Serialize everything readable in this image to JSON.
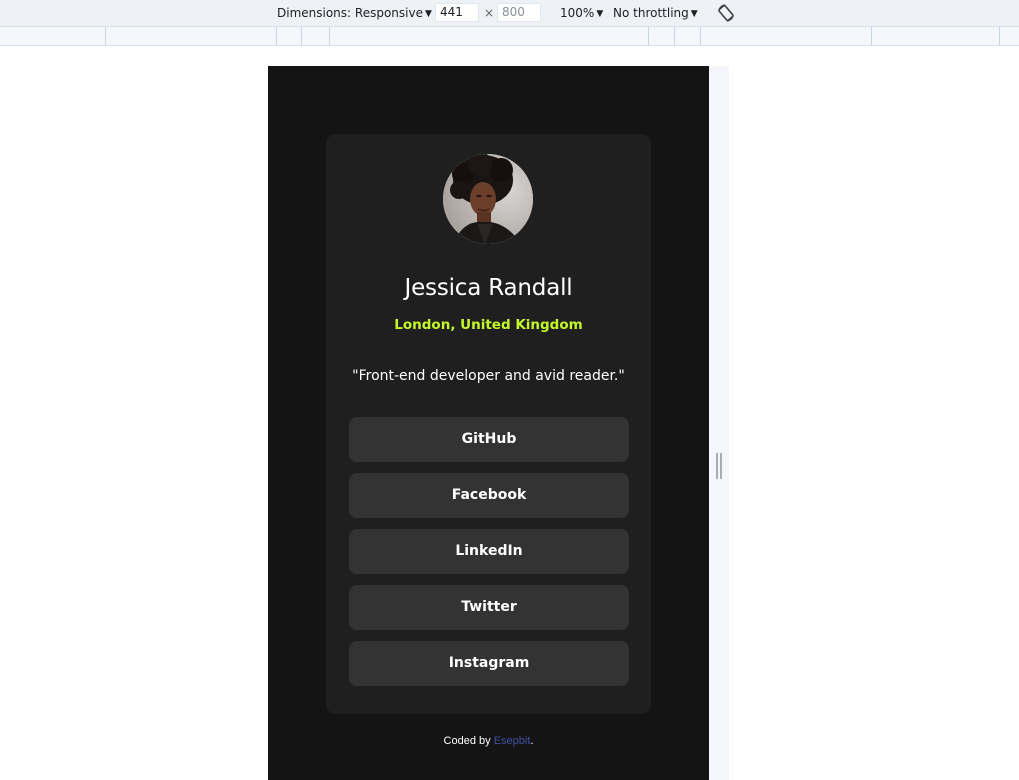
{
  "devtools": {
    "dimensions_label": "Dimensions: Responsive",
    "width_value": "441",
    "height_value": "800",
    "times_sign": "×",
    "zoom_label": "100%",
    "throttling_label": "No throttling"
  },
  "profile": {
    "name": "Jessica Randall",
    "location": "London, United Kingdom",
    "bio": "\"Front-end developer and avid reader.\"",
    "links": [
      {
        "label": "GitHub"
      },
      {
        "label": "Facebook"
      },
      {
        "label": "LinkedIn"
      },
      {
        "label": "Twitter"
      },
      {
        "label": "Instagram"
      }
    ]
  },
  "footer": {
    "prefix": "Coded by ",
    "author": "Esepbit",
    "suffix": "."
  },
  "colors": {
    "page_bg": "#141414",
    "card_bg": "#1f1f1f",
    "button_bg": "#333333",
    "accent": "#c5f82a",
    "footer_link": "#3e52a3"
  },
  "icons": {
    "dropdown": "triangle-down-icon",
    "rotate": "rotate-icon"
  }
}
